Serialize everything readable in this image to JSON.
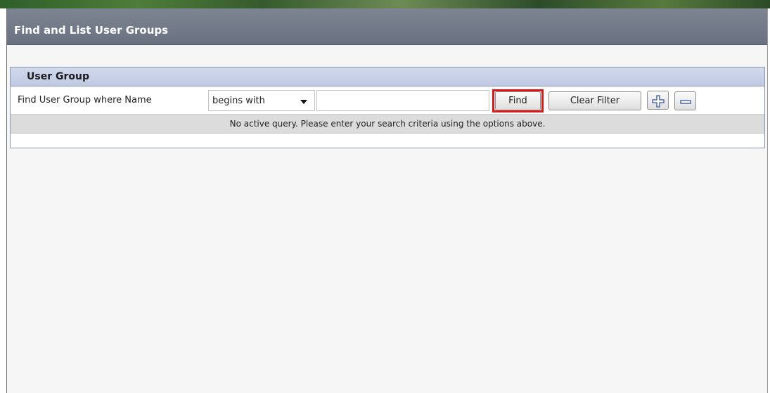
{
  "window": {
    "title": "Find and List User Groups"
  },
  "panel": {
    "header": "User Group",
    "search": {
      "label": "Find User Group where Name",
      "operator_selected": "begins with",
      "input_value": "",
      "find_label": "Find",
      "clear_filter_label": "Clear Filter",
      "add_icon": "plus-icon",
      "remove_icon": "minus-icon"
    },
    "status_message": "No active query. Please enter your search criteria using the options above."
  },
  "colors": {
    "title_bar": "#6f7684",
    "panel_header": "#c8d0e6",
    "status_row": "#dcdcdc",
    "highlight": "#e01616"
  }
}
